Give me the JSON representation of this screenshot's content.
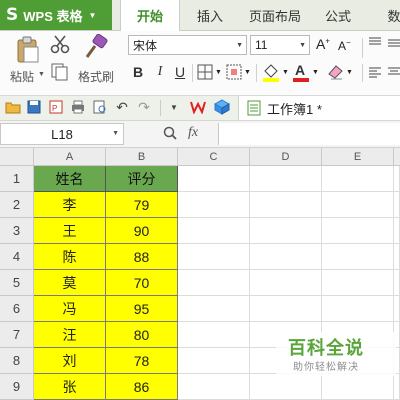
{
  "app": {
    "menu_label": "WPS 表格",
    "logo_glyph": "S",
    "tabs": [
      "开始",
      "插入",
      "页面布局",
      "公式",
      "数"
    ]
  },
  "ribbon": {
    "paste_label": "粘贴",
    "format_painter_label": "格式刷",
    "font_name": "宋体",
    "font_size": "11",
    "bold": "B",
    "italic": "I",
    "underline": "U",
    "font_color_letter": "A"
  },
  "quick_access": {
    "document_title": "工作簿1 *"
  },
  "formula_bar": {
    "cell_ref": "L18",
    "fx": "fx"
  },
  "sheet": {
    "columns": [
      "A",
      "B",
      "C",
      "D",
      "E"
    ],
    "rows": [
      "1",
      "2",
      "3",
      "4",
      "5",
      "6",
      "7",
      "8",
      "9"
    ],
    "header": [
      "姓名",
      "评分"
    ],
    "data": [
      [
        "李",
        "79"
      ],
      [
        "王",
        "90"
      ],
      [
        "陈",
        "88"
      ],
      [
        "莫",
        "70"
      ],
      [
        "冯",
        "95"
      ],
      [
        "汪",
        "80"
      ],
      [
        "刘",
        "78"
      ],
      [
        "张",
        "86"
      ]
    ]
  },
  "watermark": {
    "title": "百科全说",
    "subtitle": "助你轻松解决"
  },
  "colors": {
    "brand_green": "#4f9d35",
    "header_fill": "#6aa84f",
    "highlight_yellow": "#ffff00"
  }
}
